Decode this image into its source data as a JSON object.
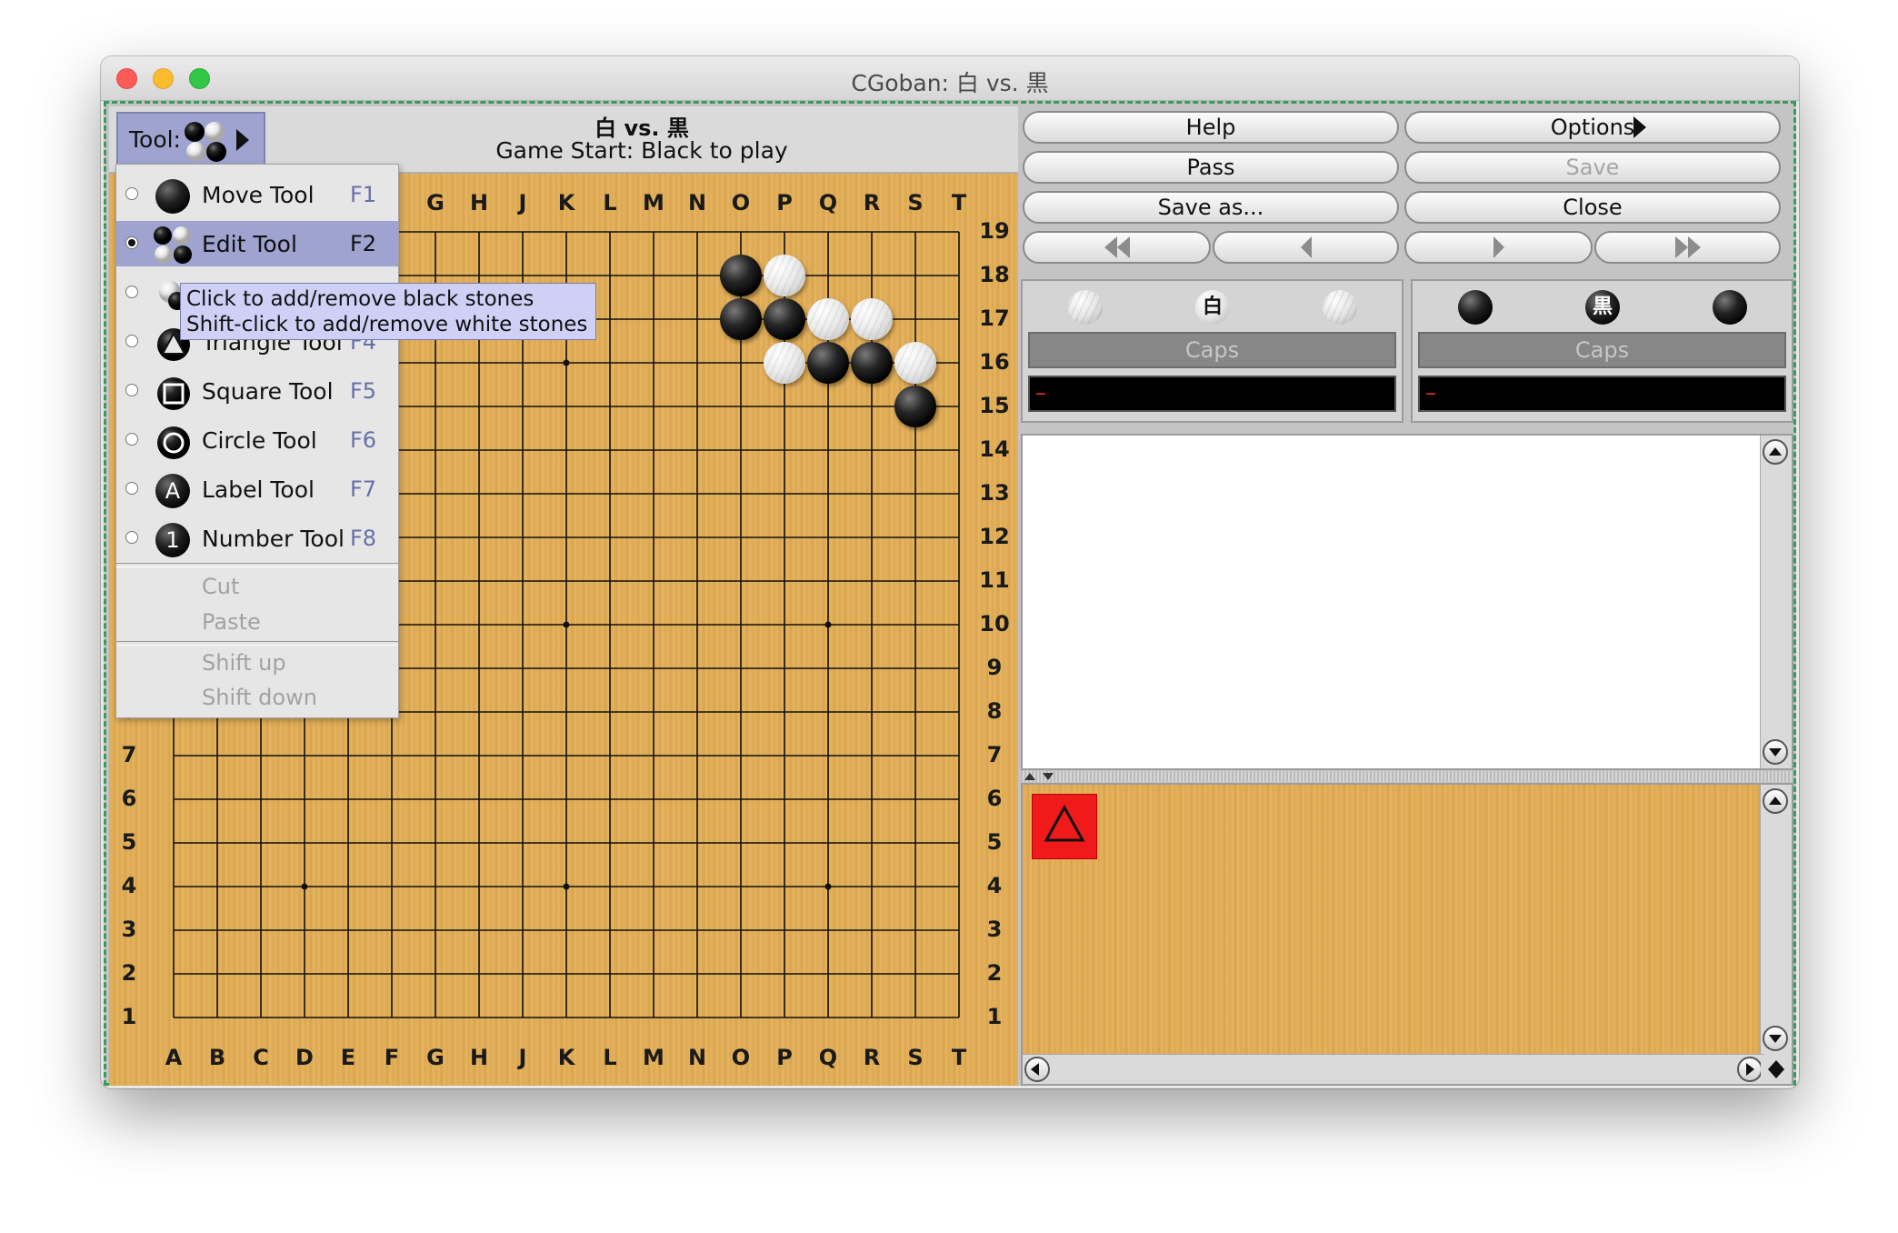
{
  "window": {
    "title": "CGoban: 白 vs. 黒"
  },
  "header": {
    "tool_label": "Tool:",
    "match_title": "白 vs. 黒",
    "status": "Game Start: Black to play"
  },
  "board": {
    "size": 19,
    "columns": [
      "A",
      "B",
      "C",
      "D",
      "E",
      "F",
      "G",
      "H",
      "J",
      "K",
      "L",
      "M",
      "N",
      "O",
      "P",
      "Q",
      "R",
      "S",
      "T"
    ],
    "rows": [
      "19",
      "18",
      "17",
      "16",
      "15",
      "14",
      "13",
      "12",
      "11",
      "10",
      "9",
      "8",
      "7",
      "6",
      "5",
      "4",
      "3",
      "2",
      "1"
    ],
    "star_points": [
      "D16",
      "K16",
      "Q16",
      "D10",
      "K10",
      "Q10",
      "D4",
      "K4",
      "Q4"
    ],
    "stones": [
      {
        "point": "O18",
        "color": "black"
      },
      {
        "point": "P18",
        "color": "white"
      },
      {
        "point": "O17",
        "color": "black"
      },
      {
        "point": "P17",
        "color": "black"
      },
      {
        "point": "Q17",
        "color": "white"
      },
      {
        "point": "R17",
        "color": "white"
      },
      {
        "point": "P16",
        "color": "white"
      },
      {
        "point": "Q16",
        "color": "black"
      },
      {
        "point": "R16",
        "color": "black"
      },
      {
        "point": "S16",
        "color": "white"
      },
      {
        "point": "S15",
        "color": "black"
      }
    ]
  },
  "tool_menu": {
    "items": [
      {
        "label": "Move Tool",
        "key": "F1",
        "icon": "black-stone-icon",
        "selected": false
      },
      {
        "label": "Edit Tool",
        "key": "F2",
        "icon": "edit-stones-icon",
        "selected": true
      },
      {
        "label": "Triangle Tool",
        "key": "F4",
        "icon": "triangle-icon",
        "selected": false
      },
      {
        "label": "Square Tool",
        "key": "F5",
        "icon": "square-icon",
        "selected": false
      },
      {
        "label": "Circle Tool",
        "key": "F6",
        "icon": "circle-icon",
        "selected": false
      },
      {
        "label": "Label Tool",
        "key": "F7",
        "icon": "label-icon",
        "icon_text": "A",
        "selected": false
      },
      {
        "label": "Number Tool",
        "key": "F8",
        "icon": "number-icon",
        "icon_text": "1",
        "selected": false
      }
    ],
    "cut": "Cut",
    "paste": "Paste",
    "shift_up": "Shift up",
    "shift_down": "Shift down"
  },
  "tooltip": {
    "line1": "Click to add/remove black stones",
    "line2": "Shift-click to add/remove white stones"
  },
  "controls": {
    "help": "Help",
    "options": "Options",
    "pass": "Pass",
    "save": "Save",
    "save_as": "Save as...",
    "close": "Close"
  },
  "players": {
    "white": {
      "name": "白",
      "caps_label": "Caps",
      "clock": "–"
    },
    "black": {
      "name": "黒",
      "caps_label": "Caps",
      "clock": "–"
    }
  },
  "colors": {
    "selection": "#9ea3cf",
    "tooltip_bg": "#cfd0f6",
    "tree_node": "#f01a1a",
    "board_wood": "#e0ac55",
    "window_border": "#3a9a5a"
  }
}
